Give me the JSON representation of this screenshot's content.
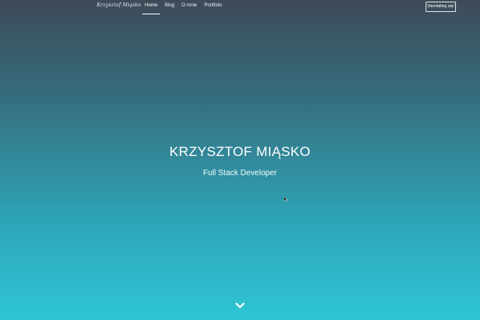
{
  "header": {
    "brand": "Krzysztof Miąsko",
    "nav": [
      {
        "label": "Home",
        "active": true
      },
      {
        "label": "Blog",
        "active": false
      },
      {
        "label": "O mnie",
        "active": false
      },
      {
        "label": "Portfolio",
        "active": false
      }
    ],
    "contact_label": "Skontaktuj się!"
  },
  "hero": {
    "name": "KRZYSZTOF MIĄSKO",
    "role": "Full Stack Developer"
  },
  "icons": {
    "scroll": "chevron-down-icon",
    "cursor": "mouse-cursor-icon"
  },
  "colors": {
    "gradient_top": "#3e4a58",
    "gradient_bottom": "#2ec5d6",
    "text": "#ffffff"
  }
}
